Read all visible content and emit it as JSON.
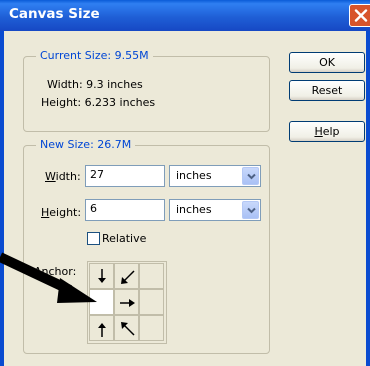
{
  "window": {
    "title": "Canvas Size"
  },
  "current_size": {
    "legend": "Current Size:  9.55M",
    "width_text": "Width: 9.3 inches",
    "height_text": "Height: 6.233 inches"
  },
  "new_size": {
    "legend": "New Size:  26.7M",
    "width_label": "Width:",
    "width_mnemonic": "W",
    "width_rest": "idth:",
    "width_value": "27",
    "width_unit": "inches",
    "height_label": "Height:",
    "height_mnemonic": "H",
    "height_rest": "eight:",
    "height_value": "6",
    "height_unit": "inches",
    "relative_label": "Relative",
    "relative_checked": false,
    "anchor_label": "Anchor:",
    "anchor_selected": "middle-left"
  },
  "buttons": {
    "ok": "OK",
    "reset": "Reset",
    "help": "Help",
    "help_mnemonic": "H",
    "help_rest": "elp"
  },
  "colors": {
    "title_bar": "#1f5fd6",
    "legend_text": "#0046d5",
    "dialog_bg": "#ece9d8",
    "close_button": "#d8542b"
  },
  "icons": {
    "close": "close-icon",
    "dropdown": "chevron-down-icon",
    "pointer": "arrow-pointer-annotation"
  }
}
